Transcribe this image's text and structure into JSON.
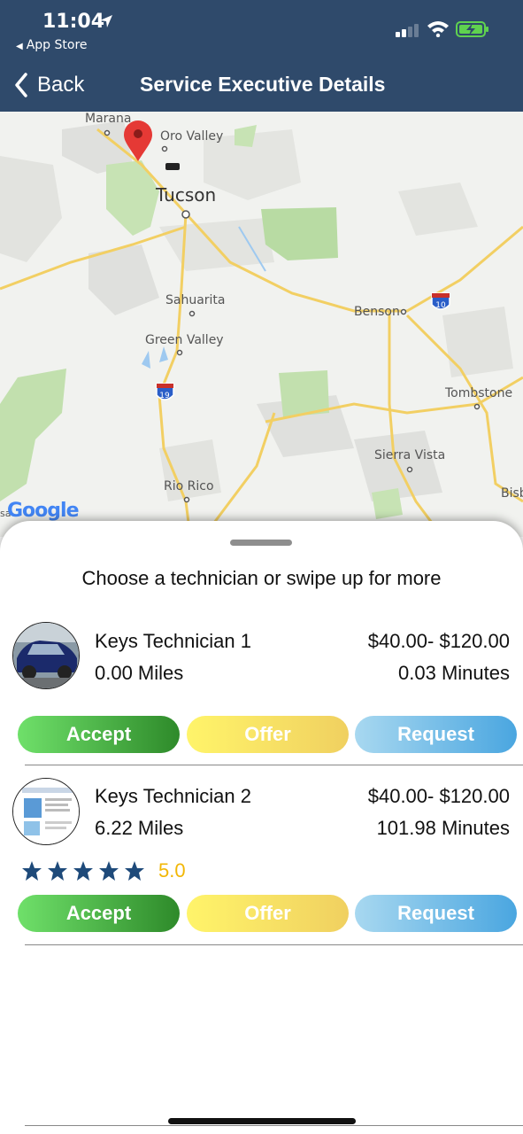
{
  "status_bar": {
    "time": "11:04",
    "back_app": "App Store"
  },
  "nav": {
    "back_label": "Back",
    "title": "Service Executive Details"
  },
  "map": {
    "places": [
      "Marana",
      "Oro Valley",
      "Tucson",
      "Sahuarita",
      "Green Valley",
      "Benson",
      "Tombstone",
      "Sierra Vista",
      "Rio Rico",
      "Bisb",
      "sa"
    ],
    "highways": [
      "10",
      "19"
    ],
    "logo": "Google"
  },
  "sheet": {
    "prompt": "Choose a technician or swipe up for more",
    "technicians": [
      {
        "name": "Keys Technician 1",
        "distance": "0.00 Miles",
        "price": "$40.00- $120.00",
        "time": "0.03 Minutes",
        "rating": "",
        "star_count": 0
      },
      {
        "name": "Keys Technician 2",
        "distance": "6.22 Miles",
        "price": "$40.00- $120.00",
        "time": "101.98 Minutes",
        "rating": "5.0",
        "star_count": 5
      }
    ],
    "buttons": {
      "accept": "Accept",
      "offer": "Offer",
      "request": "Request"
    }
  },
  "colors": {
    "nav_bg": "#2f4a6b",
    "star": "#1e4a7a",
    "rating": "#f2b705",
    "pin": "#e53935"
  }
}
